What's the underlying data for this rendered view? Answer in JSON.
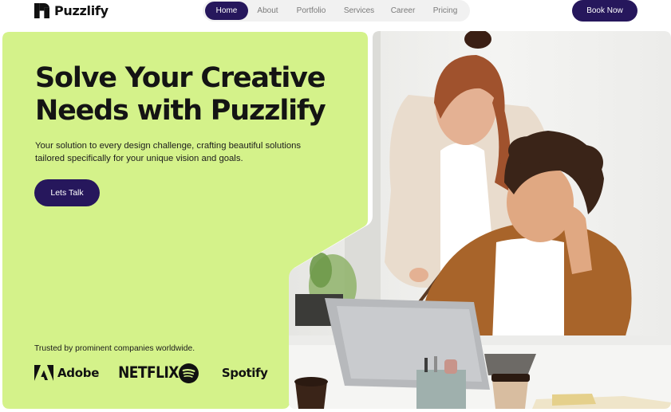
{
  "brand": {
    "name": "Puzzlify",
    "logo_icon": "puzzle-logo-icon"
  },
  "nav": {
    "items": [
      {
        "label": "Home",
        "active": true
      },
      {
        "label": "About",
        "active": false
      },
      {
        "label": "Portfolio",
        "active": false
      },
      {
        "label": "Services",
        "active": false
      },
      {
        "label": "Career",
        "active": false
      },
      {
        "label": "Pricing",
        "active": false
      }
    ],
    "book_label": "Book Now"
  },
  "hero": {
    "title_line1": "Solve Your Creative",
    "title_line2": "Needs with Puzzlify",
    "subtitle_line1": "Your solution to every design challenge, crafting beautiful solutions",
    "subtitle_line2": "tailored specifically for your unique vision and goals.",
    "cta_label": "Lets Talk"
  },
  "trusted": {
    "text": "Trusted by prominent companies worldwide.",
    "brands": [
      {
        "name": "Adobe",
        "icon": "adobe-logo-icon"
      },
      {
        "name": "NETFLIX",
        "icon": "netflix-wordmark"
      },
      {
        "name": "Spotify",
        "icon": "spotify-logo-icon"
      }
    ]
  },
  "colors": {
    "accent": "#26175c",
    "hero_bg": "#d4f28a",
    "nav_bg": "#f1f1f1"
  }
}
